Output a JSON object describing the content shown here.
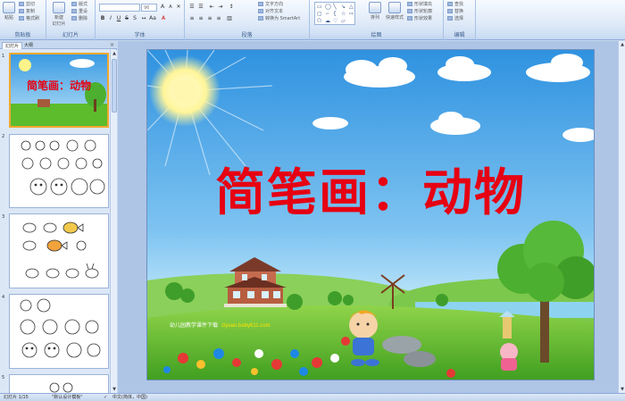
{
  "ribbon": {
    "clipboard": {
      "paste": "粘贴",
      "cut": "剪切",
      "copy": "复制",
      "format_painter": "格式刷",
      "group": "剪贴板"
    },
    "slides": {
      "new_slide": "新建\n幻灯片",
      "layout": "版式",
      "reset": "重设",
      "delete": "删除",
      "group": "幻灯片"
    },
    "font": {
      "font_name": "",
      "font_size": "96",
      "group": "字体"
    },
    "paragraph": {
      "text_direction": "文字方向",
      "align_text": "对齐文本",
      "convert_smartart": "转换为 SmartArt",
      "group": "段落"
    },
    "drawing": {
      "arrange": "排列",
      "quick_styles": "快速样式",
      "shape_fill": "形状填充",
      "shape_outline": "形状轮廓",
      "shape_effects": "形状效果",
      "group": "绘图"
    },
    "editing": {
      "find": "查找",
      "replace": "替换",
      "select": "选择",
      "group": "编辑"
    }
  },
  "left_panel": {
    "tabs": [
      "幻灯片",
      "大纲"
    ],
    "close": "×",
    "slide_numbers": [
      "1",
      "2",
      "3",
      "4",
      "5"
    ],
    "thumb1_title": "简笔画：动物"
  },
  "slide": {
    "title": "简笔画：动物",
    "watermark_text": "幼儿园教学课件下载",
    "watermark_url": "ziyuan.baby611.com"
  },
  "status_bar": {
    "slide_info": "幻灯片 1/15",
    "theme": "\"默认设计模板\"",
    "language": "中文(简体，中国)"
  },
  "colors": {
    "title_red": "#e60012",
    "sky_blue": "#3fa3e8",
    "grass_green": "#5cbc2c",
    "selection_orange": "#f0a830"
  }
}
